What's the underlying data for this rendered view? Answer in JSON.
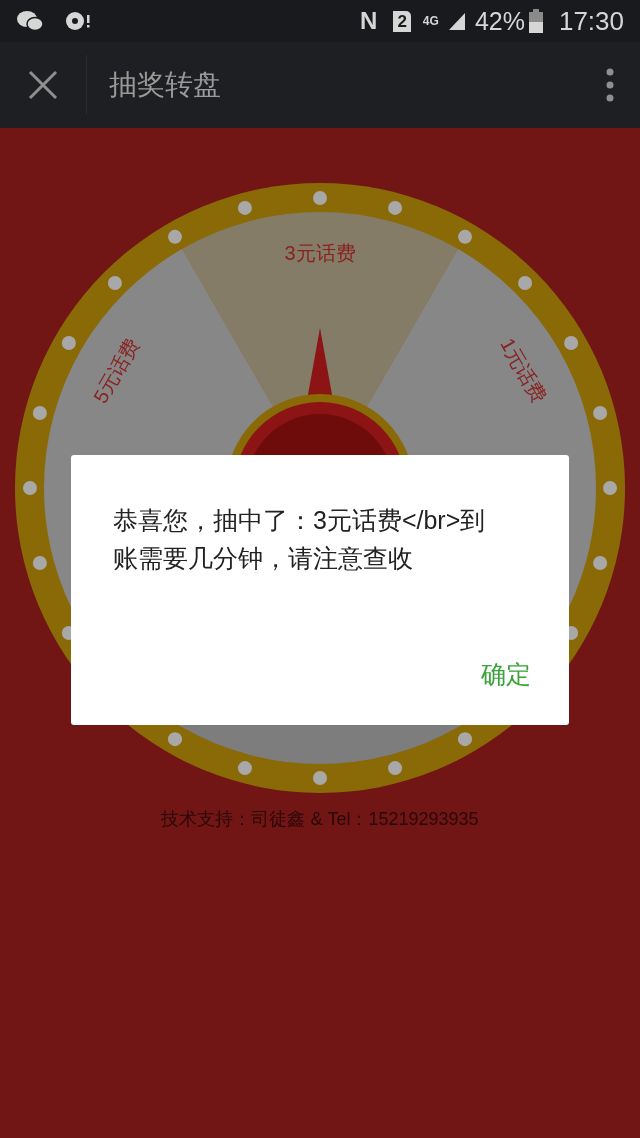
{
  "status_bar": {
    "nfc": "N",
    "sim": "2",
    "network": "4G",
    "battery": "42%",
    "time": "17:30"
  },
  "app_bar": {
    "title": "抽奖转盘"
  },
  "wheel": {
    "sectors": [
      {
        "label": "3元话费",
        "selected": true
      },
      {
        "label": "1元话费",
        "selected": false
      },
      {
        "label": "5元话费",
        "selected": false
      }
    ]
  },
  "footer": "技术支持：司徒鑫 & Tel：15219293935",
  "dialog": {
    "message": "恭喜您，抽中了：3元话费</br>到账需要几分钟，请注意查收",
    "button": "确定"
  }
}
